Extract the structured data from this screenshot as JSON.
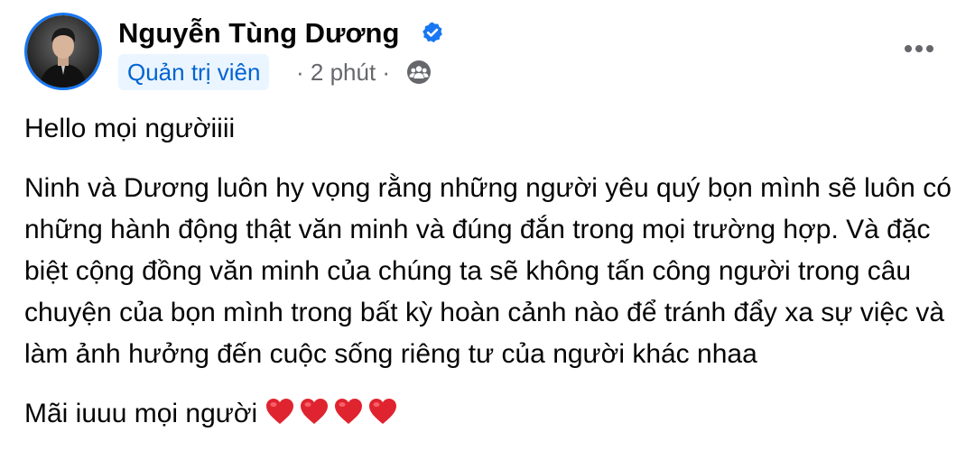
{
  "author": {
    "name": "Nguyễn Tùng Dương",
    "verified_icon": "verified-badge-icon",
    "role": "Quản trị viên",
    "time": "· 2 phút ·",
    "audience_icon": "friends-audience-icon"
  },
  "menu": {
    "icon": "more-options-icon"
  },
  "post": {
    "greeting": "Hello mọi ngườiiii",
    "body": "Ninh và Dương luôn hy vọng rằng những người yêu quý bọn mình sẽ luôn có những hành động thật văn minh và đúng đắn trong mọi trường hợp. Và đặc biệt cộng đồng văn minh của chúng ta sẽ không tấn công người trong câu chuyện của bọn mình trong bất kỳ hoàn cảnh nào để tránh đẩy xa sự việc và làm ảnh hưởng đến cuộc sống riêng tư của người khác nhaa",
    "closing": "Mãi iuuu mọi người",
    "emoji": [
      "heart-icon",
      "heart-icon",
      "heart-icon",
      "heart-icon"
    ]
  },
  "colors": {
    "accent": "#1877f2",
    "badge_bg": "#ebf5ff",
    "badge_text": "#0064d1",
    "secondary_text": "#65676b",
    "heart": "#e0242f"
  }
}
